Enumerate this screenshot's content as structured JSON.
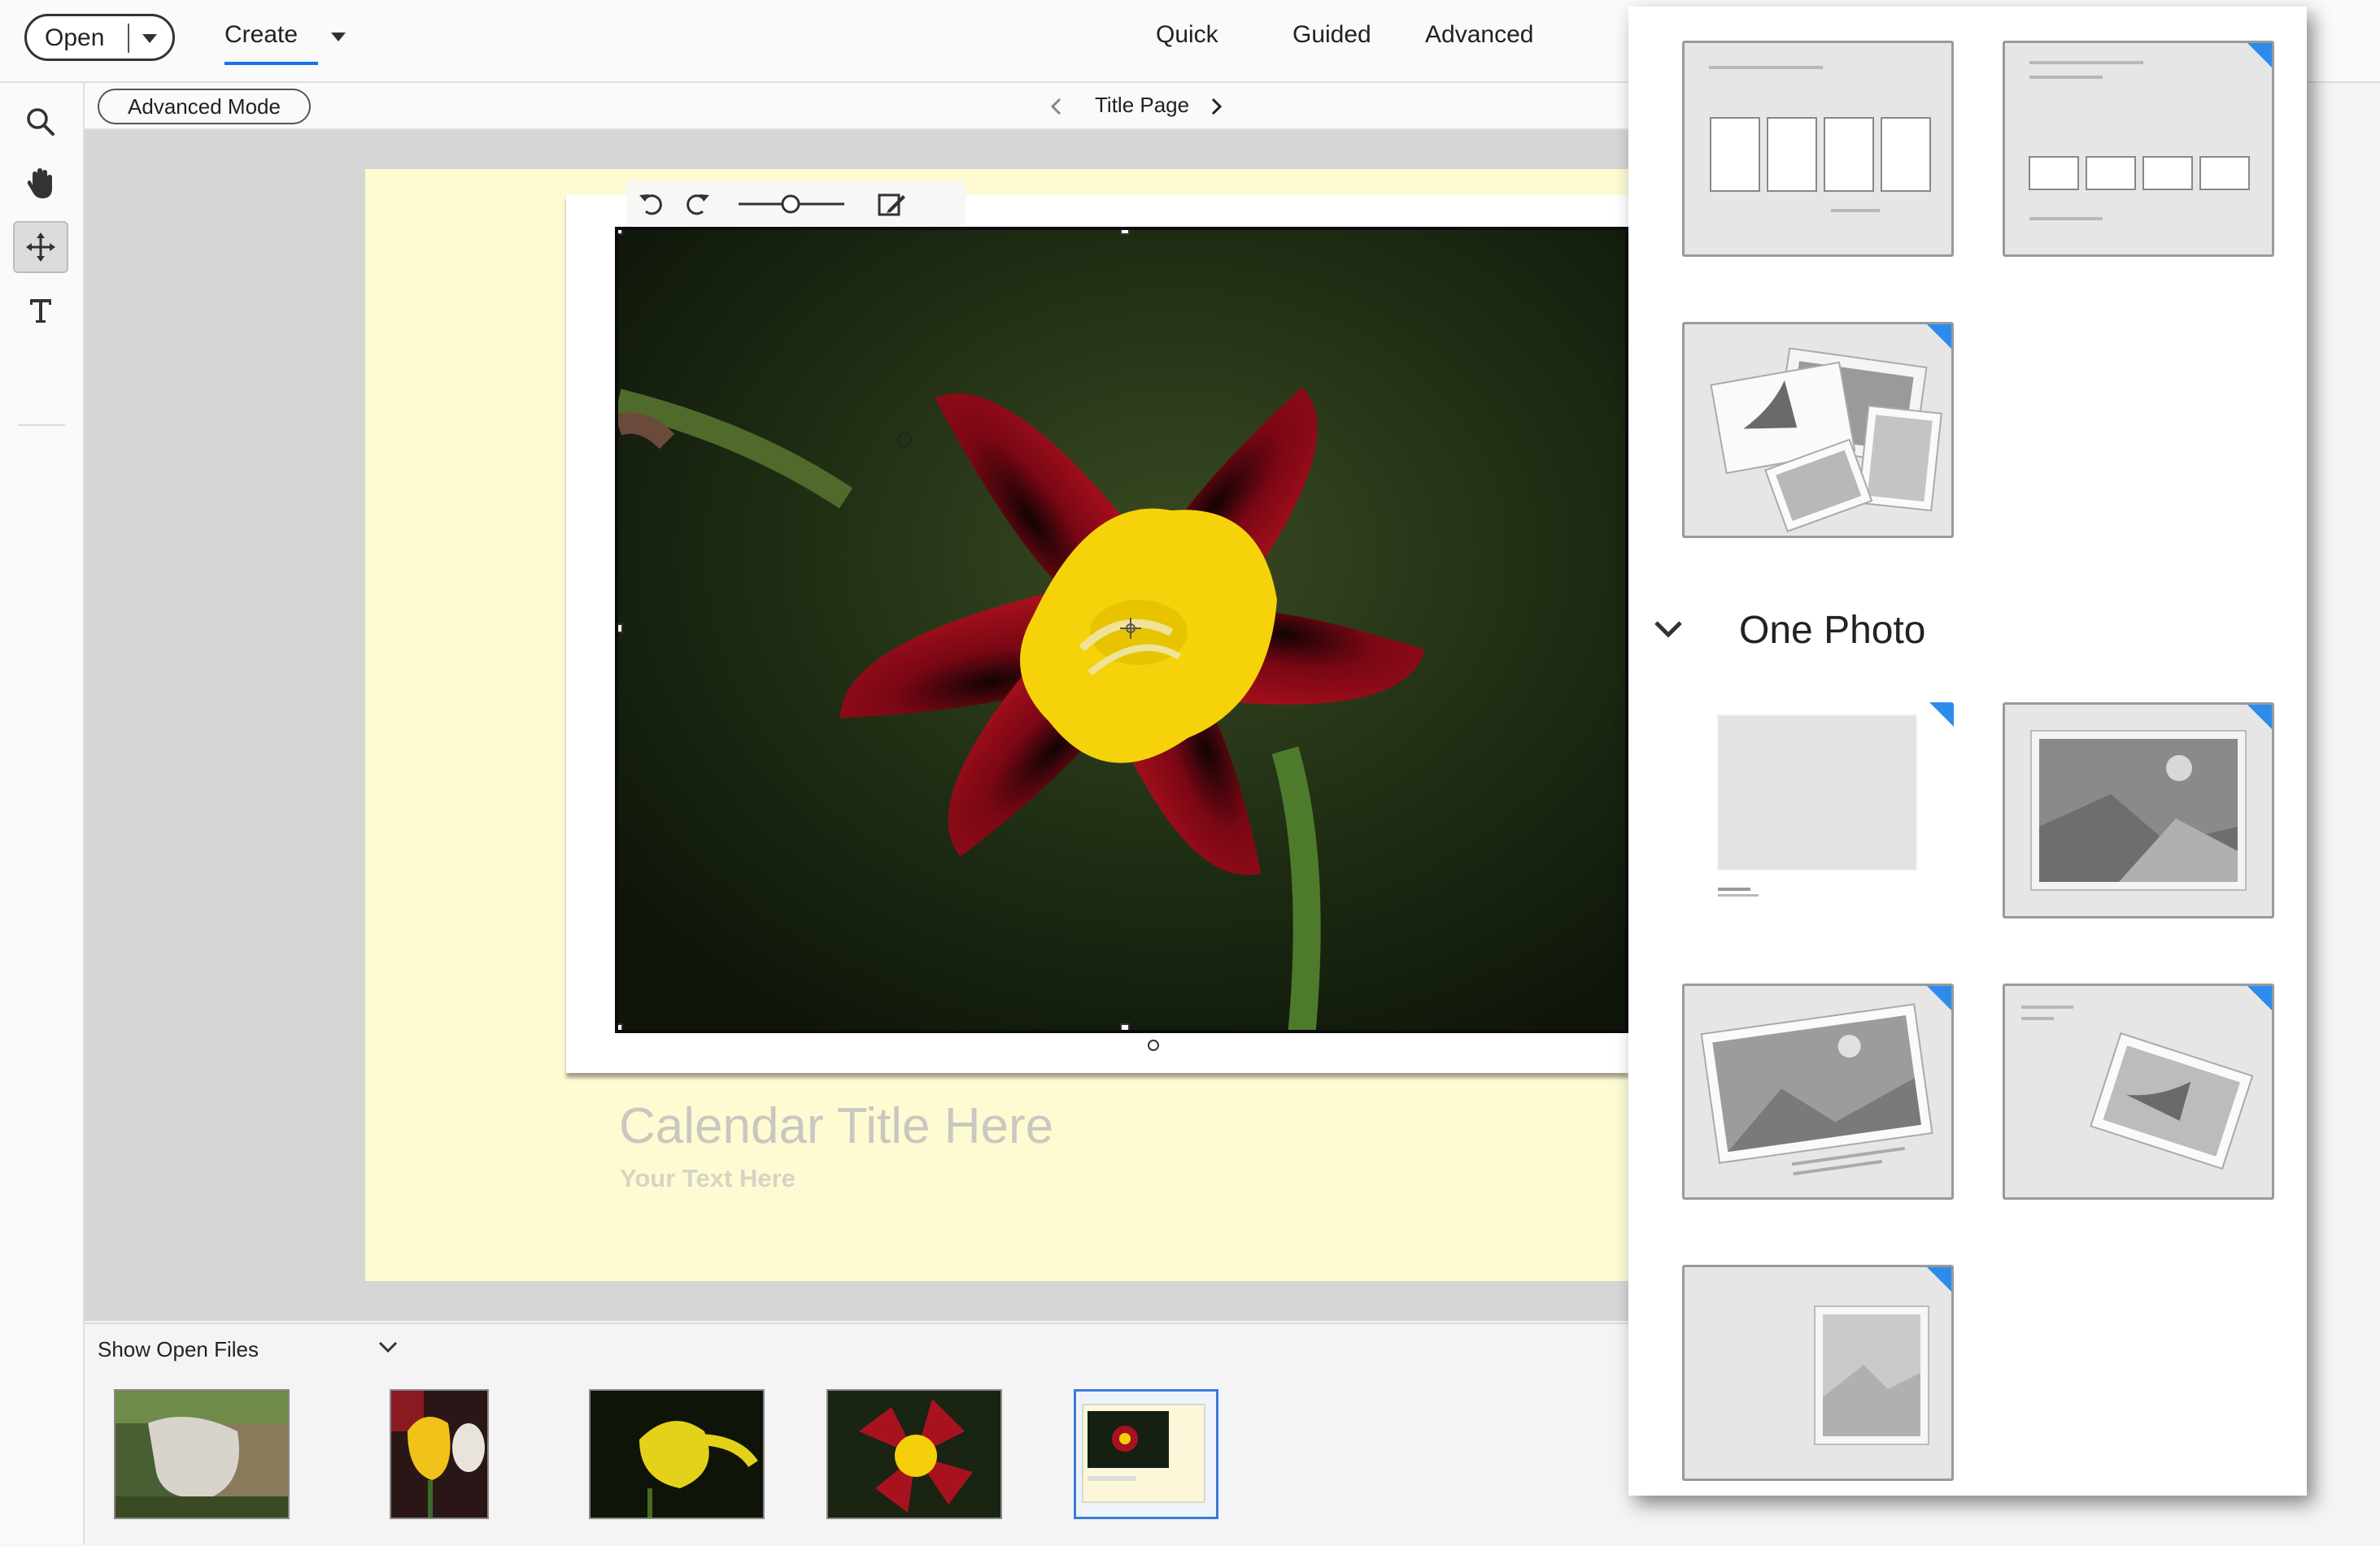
{
  "topbar": {
    "open_label": "Open",
    "create_label": "Create",
    "modes": [
      "Quick",
      "Guided",
      "Advanced"
    ]
  },
  "subbar": {
    "advanced_mode_label": "Advanced Mode",
    "page_label": "Title Page"
  },
  "tools": [
    "zoom",
    "hand",
    "move",
    "text"
  ],
  "calendar": {
    "title_placeholder": "Calendar Title Here",
    "subtitle_placeholder": "Your Text Here"
  },
  "photo_bin": {
    "label": "Show Open Files",
    "thumbnails": [
      "wisteria-garden",
      "yellow-tulip",
      "yellow-lily",
      "red-yellow-flower",
      "calendar-project"
    ],
    "selected_index": 4
  },
  "layouts_panel": {
    "section_one_photo": "One Photo"
  },
  "colors": {
    "accent": "#1473e6",
    "page_background": "#fefbd3",
    "card_corner": "#2d8ceb"
  }
}
